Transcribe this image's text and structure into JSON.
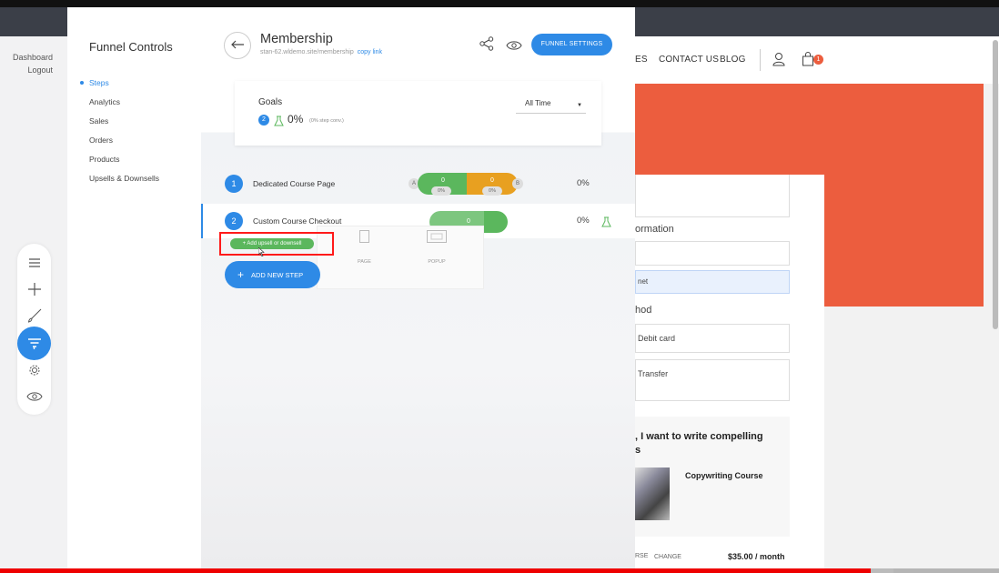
{
  "app": {
    "left_links": [
      "Dashboard",
      "Logout"
    ]
  },
  "controls": {
    "title": "Funnel Controls",
    "nav": [
      {
        "label": "Steps",
        "active": true
      },
      {
        "label": "Analytics",
        "active": false
      },
      {
        "label": "Sales",
        "active": false
      },
      {
        "label": "Orders",
        "active": false
      },
      {
        "label": "Products",
        "active": false
      },
      {
        "label": "Upsells & Downsells",
        "active": false
      }
    ]
  },
  "toolbar": {
    "tools": [
      "menu-icon",
      "plus-icon",
      "brush-icon",
      "funnel-icon",
      "gear-icon",
      "eye-icon"
    ],
    "active_tool": "funnel-icon"
  },
  "header": {
    "title": "Membership",
    "url": "stan-62.wldemo.site/membership",
    "copy_link": "copy link",
    "settings_button": "FUNNEL SETTINGS"
  },
  "goals": {
    "label": "Goals",
    "badge": "2",
    "percent": "0%",
    "sub": "(0% step conv.)",
    "range": "All Time"
  },
  "steps": [
    {
      "num": "1",
      "name": "Dedicated Course Page",
      "pct": "0%",
      "split": {
        "a_label": "A",
        "b_label": "B",
        "a_value": "0",
        "b_value": "0",
        "a_pct": "0%",
        "b_pct": "0%"
      }
    },
    {
      "num": "2",
      "name": "Custom Course Checkout",
      "pct": "0%",
      "value": "0"
    }
  ],
  "popup_options": [
    "PAGE",
    "POPUP"
  ],
  "upsell_button": "+ Add upsell or downsell",
  "add_step_button": "ADD NEW STEP",
  "site": {
    "nav": [
      "ES",
      "CONTACT US",
      "BLOG"
    ],
    "cart_count": "1",
    "labels": [
      "ormation",
      "hod"
    ],
    "fields": [
      "",
      "net",
      "Debit card",
      "Transfer"
    ],
    "offer_title": ", I want to write compelling\ns",
    "offer_product": "Copywriting Course",
    "footer_left": "RSE",
    "footer_change": "CHANGE",
    "footer_price": "$35.00 / month"
  },
  "video": {
    "progress_fraction": 0.872,
    "buffered_fraction": 0.895
  },
  "colors": {
    "accent": "#2e8ae6",
    "green": "#5bb75d",
    "orange": "#e8a020",
    "hero": "#ec5d3e",
    "highlight": "#ff1a1a"
  }
}
